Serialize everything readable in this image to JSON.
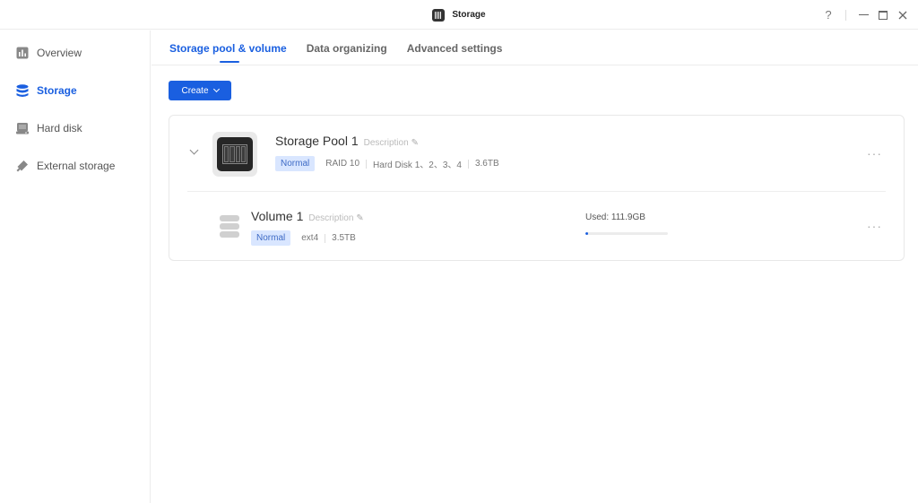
{
  "window": {
    "title": "Storage",
    "help": "?"
  },
  "sidebar": {
    "items": [
      {
        "label": "Overview",
        "icon": "chart-icon"
      },
      {
        "label": "Storage",
        "icon": "database-icon",
        "active": true
      },
      {
        "label": "Hard disk",
        "icon": "hard-disk-icon"
      },
      {
        "label": "External storage",
        "icon": "usb-drive-icon"
      }
    ]
  },
  "tabs": [
    {
      "label": "Storage pool & volume",
      "active": true
    },
    {
      "label": "Data organizing"
    },
    {
      "label": "Advanced settings"
    }
  ],
  "toolbar": {
    "create_label": "Create"
  },
  "pool": {
    "name": "Storage Pool 1",
    "description": "Description",
    "status": "Normal",
    "raid": "RAID 10",
    "disks": "Hard Disk 1、2、3、4",
    "size": "3.6TB",
    "more": "···"
  },
  "volume": {
    "name": "Volume 1",
    "description": "Description",
    "status": "Normal",
    "filesystem": "ext4",
    "size": "3.5TB",
    "used_label": "Used: 111.9GB",
    "used_fraction": 0.031,
    "more": "···"
  },
  "colors": {
    "accent": "#1a5fe0",
    "badge_bg": "#d9e6ff",
    "badge_text": "#3f6bc5"
  }
}
